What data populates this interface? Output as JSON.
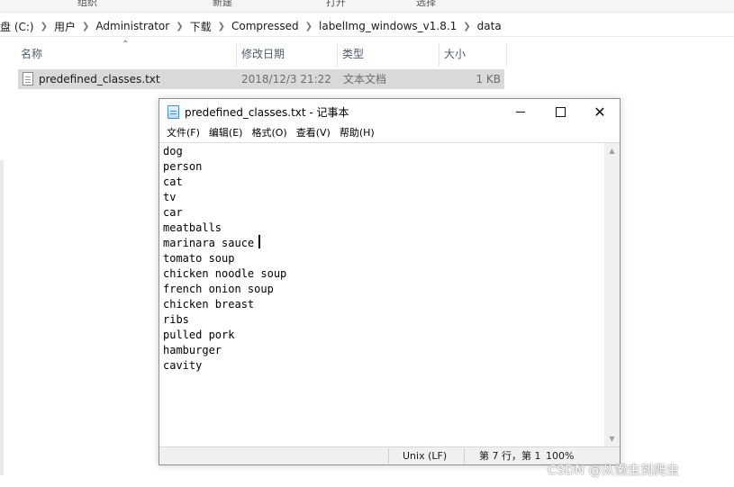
{
  "ribbon": {
    "labels": [
      "组织",
      "新建",
      "打开",
      "选择"
    ]
  },
  "breadcrumb": {
    "items": [
      "盘 (C:)",
      "用户",
      "Administrator",
      "下载",
      "Compressed",
      "labelImg_windows_v1.8.1",
      "data"
    ]
  },
  "file_list": {
    "columns": {
      "name": "名称",
      "modified": "修改日期",
      "type": "类型",
      "size": "大小"
    },
    "rows": [
      {
        "name": "predefined_classes.txt",
        "modified": "2018/12/3 21:22",
        "type": "文本文档",
        "size": "1 KB"
      }
    ]
  },
  "notepad": {
    "title": "predefined_classes.txt - 记事本",
    "window_buttons": {
      "close": "✕"
    },
    "menu": [
      "文件(F)",
      "编辑(E)",
      "格式(O)",
      "查看(V)",
      "帮助(H)"
    ],
    "lines": [
      "dog",
      "person",
      "cat",
      "tv",
      "car",
      "meatballs",
      "marinara sauce",
      "tomato soup",
      "chicken noodle soup",
      "french onion soup",
      "chicken breast",
      "ribs",
      "pulled pork",
      "hamburger",
      "cavity"
    ],
    "status": {
      "line_ending": "Unix (LF)",
      "position": "第 7 行，第 1",
      "zoom": "100%"
    }
  },
  "watermark": "CSDN @从懒虫到爬虫"
}
